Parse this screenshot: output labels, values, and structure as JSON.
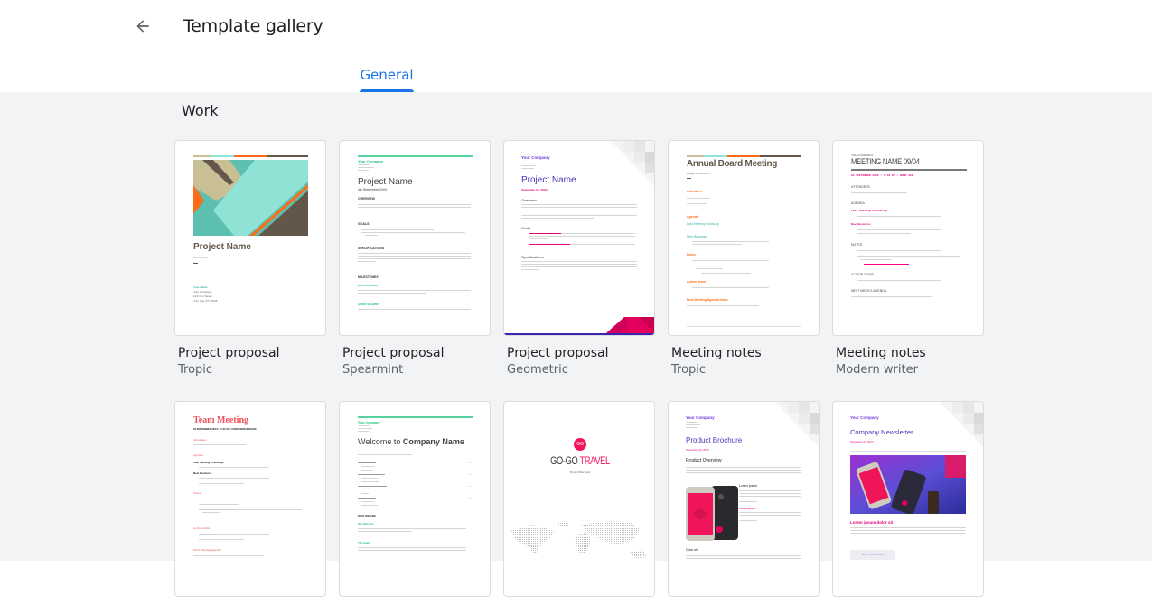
{
  "header": {
    "back_icon": "arrow-left-icon",
    "title": "Template gallery"
  },
  "tabs": [
    {
      "label": "General",
      "selected": true
    }
  ],
  "colors": {
    "accent": "#1a73e8",
    "background": "#f1f3f4",
    "title_text": "#202124",
    "sub_text": "#5f6368"
  },
  "section": {
    "title": "Work"
  },
  "templates": [
    {
      "name": "Project proposal",
      "style": "Tropic",
      "thumb": {
        "heading": "Project Name",
        "date": "09.04.20XX",
        "contact_name": "Your Name",
        "contact_lines": [
          "Your Company",
          "123 Your Street",
          "Your City, ST 12345"
        ]
      }
    },
    {
      "name": "Project proposal",
      "style": "Spearmint",
      "thumb": {
        "company": "Your Company",
        "heading": "Project Name",
        "date": "4th September 20XX",
        "sections": [
          "OVERVIEW",
          "GOALS",
          "SPECIFICATIONS",
          "MILESTONES"
        ],
        "subheads": [
          "Lorem ipsum",
          "Dolor Sit Amet"
        ]
      }
    },
    {
      "name": "Project proposal",
      "style": "Geometric",
      "thumb": {
        "company": "Your Company",
        "heading": "Project Name",
        "date": "September 04, 20XX",
        "sections": [
          "Overview",
          "Goals",
          "Specifications"
        ]
      }
    },
    {
      "name": "Meeting notes",
      "style": "Tropic",
      "thumb": {
        "heading": "Annual Board Meeting",
        "date": "Friday, 09.04.20XX",
        "sections": [
          "Attendees",
          "Agenda",
          "Notes",
          "Action Items",
          "Next Meeting Agenda Items"
        ],
        "subheads": [
          "Last Meeting Follow-up",
          "New Business"
        ]
      }
    },
    {
      "name": "Meeting notes",
      "style": "Modern writer",
      "thumb": {
        "company": "YOUR COMPANY",
        "heading": "MEETING NAME 09/04",
        "date": "04 SEPTEMBER 20XX / 6:10 PM / ROOM 436",
        "sections": [
          "ATTENDEES",
          "AGENDA",
          "NOTES",
          "ACTION ITEMS",
          "NEXT WEEK'S AGENDA"
        ],
        "subheads": [
          "Last Meeting Follow-up",
          "New Business"
        ]
      }
    },
    {
      "name": "",
      "style": "",
      "thumb": {
        "heading": "Team Meeting",
        "date": "09 SEPTEMBER 20XX / 10:00 AM / CONFERENCE ROOM",
        "sections": [
          "Attendees",
          "Agenda",
          "Notes",
          "Action Items",
          "Next Meeting Agenda"
        ],
        "subheads": [
          "Last Meeting Follow-up",
          "New Business"
        ]
      }
    },
    {
      "name": "",
      "style": "",
      "thumb": {
        "company": "Your Company",
        "heading_pre": "Welcome to ",
        "heading_bold": "Company Name",
        "sections": [
          "WHO WE ARE"
        ],
        "subheads": [
          "Our Mission",
          "The team"
        ]
      }
    },
    {
      "name": "",
      "style": "",
      "thumb": {
        "logo": "GG",
        "heading_a": "GO-GO ",
        "heading_b": "TRAVEL",
        "subtitle": "Travel Brochure"
      }
    },
    {
      "name": "",
      "style": "",
      "thumb": {
        "company": "Your Company",
        "heading": "Product Brochure",
        "date": "September 04, 20XX",
        "sections": [
          "Product Overview",
          "Dolor sit"
        ],
        "subheads": [
          "Lorem ipsum",
          "Lorem ipsum"
        ]
      }
    },
    {
      "name": "",
      "style": "",
      "thumb": {
        "company": "Your Company",
        "heading": "Company Newsletter",
        "date": "September 04, 20XX",
        "subhead": "Lorem ipsum dolor sit",
        "button": "Visit our latest site"
      }
    }
  ]
}
